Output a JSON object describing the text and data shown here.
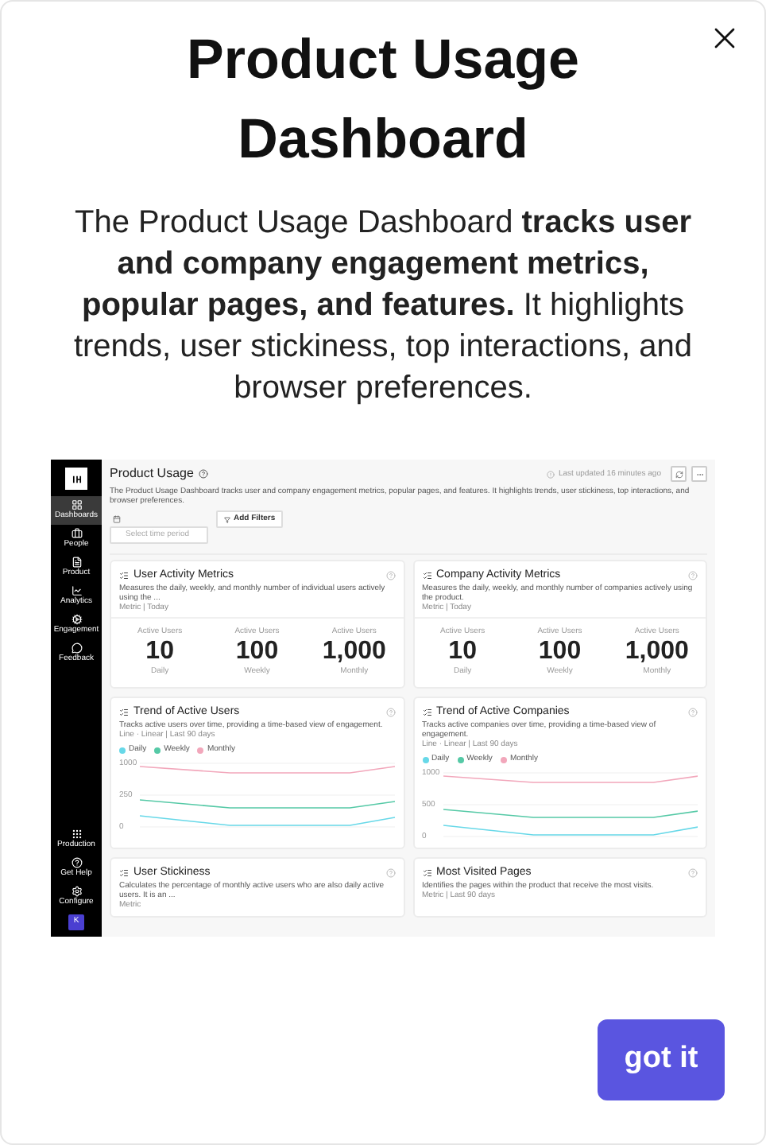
{
  "dialog": {
    "title": "Product Usage Dashboard",
    "description": "The Product Usage Dashboard **tracks user and company engagement metrics, popular pages, and features.** It highlights trends, user stickiness, top interactions, and browser preferences.",
    "button": "got it"
  },
  "preview": {
    "sidebar": {
      "items": [
        {
          "label": "Dashboards",
          "selected": true
        },
        {
          "label": "People",
          "selected": false
        },
        {
          "label": "Product",
          "selected": false
        },
        {
          "label": "Analytics",
          "selected": false
        },
        {
          "label": "Engagement",
          "selected": false
        },
        {
          "label": "Feedback",
          "selected": false
        }
      ],
      "bottom_items": [
        {
          "label": "Production"
        },
        {
          "label": "Get Help"
        },
        {
          "label": "Configure"
        }
      ],
      "avatar": "K"
    },
    "header": {
      "title": "Product Usage",
      "description": "The Product Usage Dashboard tracks user and company engagement metrics, popular pages, and features. It highlights trends, user stickiness, top interactions, and browser preferences.",
      "last_updated": "Last updated 16 minutes ago"
    },
    "filters": {
      "time_placeholder": "Select time period",
      "add_filters": "Add Filters"
    },
    "cards": [
      {
        "kind": "metrics",
        "title": "User Activity Metrics",
        "description": "Measures the daily, weekly, and monthly number of individual users actively using the ...",
        "meta": "Metric | Today",
        "metrics": [
          {
            "label": "Active Users",
            "value": "10",
            "period": "Daily"
          },
          {
            "label": "Active Users",
            "value": "100",
            "period": "Weekly"
          },
          {
            "label": "Active Users",
            "value": "1,000",
            "period": "Monthly"
          }
        ]
      },
      {
        "kind": "metrics",
        "title": "Company Activity Metrics",
        "description": "Measures the daily, weekly, and monthly number of companies actively using the product.",
        "meta": "Metric | Today",
        "metrics": [
          {
            "label": "Active Users",
            "value": "10",
            "period": "Daily"
          },
          {
            "label": "Active Users",
            "value": "100",
            "period": "Weekly"
          },
          {
            "label": "Active Users",
            "value": "1,000",
            "period": "Monthly"
          }
        ]
      },
      {
        "kind": "trend",
        "title": "Trend of Active Users",
        "description": "Tracks active users over time, providing a time-based view of engagement.",
        "meta": "Line · Linear | Last 90 days",
        "legend": [
          {
            "label": "Daily",
            "color": "#67d8e8"
          },
          {
            "label": "Weekly",
            "color": "#55c9a6"
          },
          {
            "label": "Monthly",
            "color": "#f2a7bb"
          }
        ],
        "yticks": [
          "1000",
          "250",
          "0"
        ]
      },
      {
        "kind": "trend",
        "title": "Trend of Active Companies",
        "description": "Tracks active companies over time, providing a time-based view of engagement.",
        "meta": "Line · Linear | Last 90 days",
        "legend": [
          {
            "label": "Daily",
            "color": "#67d8e8"
          },
          {
            "label": "Weekly",
            "color": "#55c9a6"
          },
          {
            "label": "Monthly",
            "color": "#f2a7bb"
          }
        ],
        "yticks": [
          "1000",
          "500",
          "0"
        ]
      },
      {
        "kind": "info",
        "title": "User Stickiness",
        "description": "Calculates the percentage of monthly active users who are also daily active users. It is an ...",
        "meta": "Metric"
      },
      {
        "kind": "info",
        "title": "Most Visited Pages",
        "description": "Identifies the pages within the product that receive the most visits.",
        "meta": "Metric | Last 90 days"
      }
    ]
  }
}
